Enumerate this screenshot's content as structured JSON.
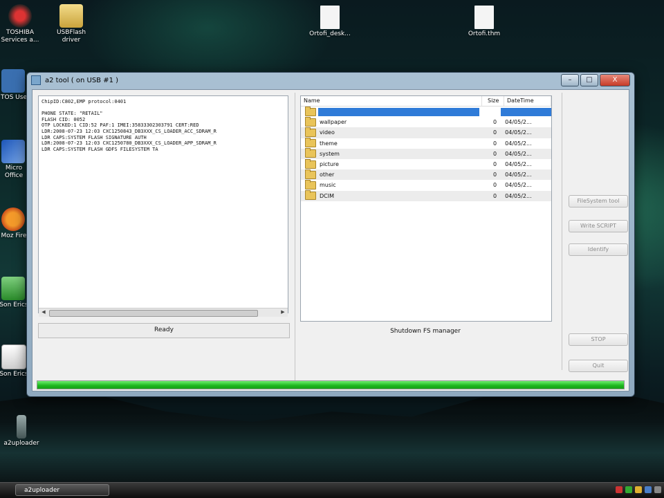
{
  "desktop": {
    "icons": [
      {
        "label": "TOSHIBA Services a...",
        "name": "toshiba-services-icon"
      },
      {
        "label": "USBFlash driver",
        "name": "usbflash-driver-icon"
      },
      {
        "label": "Ortofi_desk...",
        "name": "file-icon-1"
      },
      {
        "label": "Ortofi.thm",
        "name": "file-icon-2"
      },
      {
        "label": "TOS Use",
        "name": "toshiba-user-icon"
      },
      {
        "label": "Micro Office",
        "name": "microsoft-office-icon"
      },
      {
        "label": "Moz Fire",
        "name": "mozilla-firefox-icon"
      },
      {
        "label": "Son Erics",
        "name": "sony-ericsson-icon-1"
      },
      {
        "label": "Son Erics",
        "name": "sony-ericsson-icon-2"
      },
      {
        "label": "a2uploader",
        "name": "a2uploader-icon"
      }
    ]
  },
  "window": {
    "title": "a2 tool ( on USB #1 )",
    "minimize": "–",
    "maximize": "□",
    "close": "X"
  },
  "log_lines": [
    "ChipID:C802,EMP protocol:0401",
    "",
    "PHONE STATE: \"RETAIL\"",
    "FLASH CID: 0052",
    "OTP LOCKED:1 CID:52 PAF:1 IMEI:35833302303791 CERT:RED",
    "LDR:2008-07-23 12:03 CXC1250843_DB3XXX_CS_LOADER_ACC_SDRAM_R",
    "LDR CAPS:SYSTEM FLASH SIGNATURE AUTH",
    "LDR:2008-07-23 12:03 CXC1250780_DB3XXX_CS_LOADER_APP_SDRAM_R",
    "LDR CAPS:SYSTEM FLASH GDFS FILESYSTEM TA"
  ],
  "status_text": "Ready",
  "file_table": {
    "headers": {
      "name": "Name",
      "size": "Size",
      "date": "DateTime"
    },
    "rows": [
      {
        "name": "",
        "size": "",
        "date": "",
        "selected": true
      },
      {
        "name": "wallpaper",
        "size": "0",
        "date": "04/05/2..."
      },
      {
        "name": "video",
        "size": "0",
        "date": "04/05/2..."
      },
      {
        "name": "theme",
        "size": "0",
        "date": "04/05/2..."
      },
      {
        "name": "system",
        "size": "0",
        "date": "04/05/2..."
      },
      {
        "name": "picture",
        "size": "0",
        "date": "04/05/2..."
      },
      {
        "name": "other",
        "size": "0",
        "date": "04/05/2..."
      },
      {
        "name": "music",
        "size": "0",
        "date": "04/05/2..."
      },
      {
        "name": "DCIM",
        "size": "0",
        "date": "04/05/2..."
      }
    ]
  },
  "shutdown_label": "Shutdown FS manager",
  "buttons": {
    "filesystem": "FileSystem tool",
    "write_script": "Write SCRIPT",
    "identify": "Identify",
    "stop": "STOP",
    "quit": "Quit"
  },
  "progress_fraction": 1.0,
  "taskbar": {
    "item": "a2uploader"
  },
  "colors": {
    "selection": "#2f7bd8",
    "progress": "#1db51d"
  }
}
